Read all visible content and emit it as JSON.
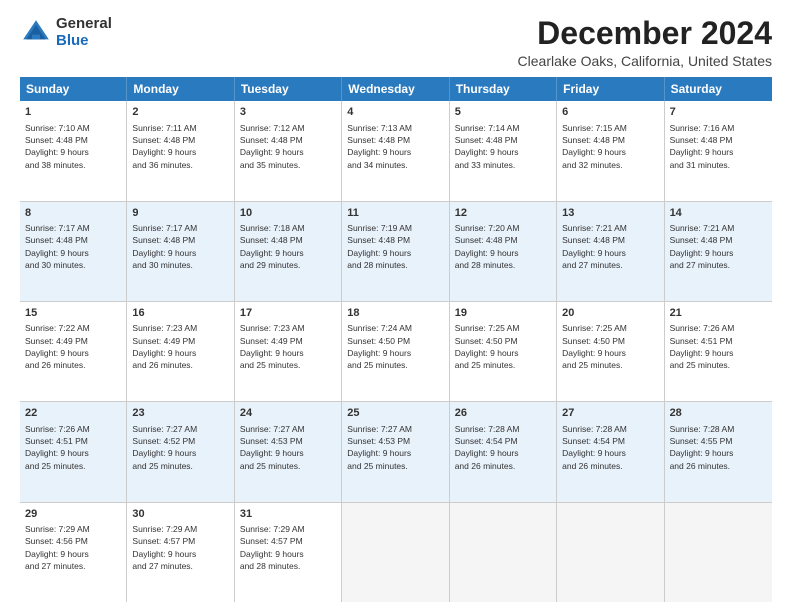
{
  "logo": {
    "general": "General",
    "blue": "Blue"
  },
  "title": "December 2024",
  "location": "Clearlake Oaks, California, United States",
  "days": [
    "Sunday",
    "Monday",
    "Tuesday",
    "Wednesday",
    "Thursday",
    "Friday",
    "Saturday"
  ],
  "weeks": [
    [
      {
        "day": "1",
        "info": "Sunrise: 7:10 AM\nSunset: 4:48 PM\nDaylight: 9 hours\nand 38 minutes."
      },
      {
        "day": "2",
        "info": "Sunrise: 7:11 AM\nSunset: 4:48 PM\nDaylight: 9 hours\nand 36 minutes."
      },
      {
        "day": "3",
        "info": "Sunrise: 7:12 AM\nSunset: 4:48 PM\nDaylight: 9 hours\nand 35 minutes."
      },
      {
        "day": "4",
        "info": "Sunrise: 7:13 AM\nSunset: 4:48 PM\nDaylight: 9 hours\nand 34 minutes."
      },
      {
        "day": "5",
        "info": "Sunrise: 7:14 AM\nSunset: 4:48 PM\nDaylight: 9 hours\nand 33 minutes."
      },
      {
        "day": "6",
        "info": "Sunrise: 7:15 AM\nSunset: 4:48 PM\nDaylight: 9 hours\nand 32 minutes."
      },
      {
        "day": "7",
        "info": "Sunrise: 7:16 AM\nSunset: 4:48 PM\nDaylight: 9 hours\nand 31 minutes."
      }
    ],
    [
      {
        "day": "8",
        "info": "Sunrise: 7:17 AM\nSunset: 4:48 PM\nDaylight: 9 hours\nand 30 minutes."
      },
      {
        "day": "9",
        "info": "Sunrise: 7:17 AM\nSunset: 4:48 PM\nDaylight: 9 hours\nand 30 minutes."
      },
      {
        "day": "10",
        "info": "Sunrise: 7:18 AM\nSunset: 4:48 PM\nDaylight: 9 hours\nand 29 minutes."
      },
      {
        "day": "11",
        "info": "Sunrise: 7:19 AM\nSunset: 4:48 PM\nDaylight: 9 hours\nand 28 minutes."
      },
      {
        "day": "12",
        "info": "Sunrise: 7:20 AM\nSunset: 4:48 PM\nDaylight: 9 hours\nand 28 minutes."
      },
      {
        "day": "13",
        "info": "Sunrise: 7:21 AM\nSunset: 4:48 PM\nDaylight: 9 hours\nand 27 minutes."
      },
      {
        "day": "14",
        "info": "Sunrise: 7:21 AM\nSunset: 4:48 PM\nDaylight: 9 hours\nand 27 minutes."
      }
    ],
    [
      {
        "day": "15",
        "info": "Sunrise: 7:22 AM\nSunset: 4:49 PM\nDaylight: 9 hours\nand 26 minutes."
      },
      {
        "day": "16",
        "info": "Sunrise: 7:23 AM\nSunset: 4:49 PM\nDaylight: 9 hours\nand 26 minutes."
      },
      {
        "day": "17",
        "info": "Sunrise: 7:23 AM\nSunset: 4:49 PM\nDaylight: 9 hours\nand 25 minutes."
      },
      {
        "day": "18",
        "info": "Sunrise: 7:24 AM\nSunset: 4:50 PM\nDaylight: 9 hours\nand 25 minutes."
      },
      {
        "day": "19",
        "info": "Sunrise: 7:25 AM\nSunset: 4:50 PM\nDaylight: 9 hours\nand 25 minutes."
      },
      {
        "day": "20",
        "info": "Sunrise: 7:25 AM\nSunset: 4:50 PM\nDaylight: 9 hours\nand 25 minutes."
      },
      {
        "day": "21",
        "info": "Sunrise: 7:26 AM\nSunset: 4:51 PM\nDaylight: 9 hours\nand 25 minutes."
      }
    ],
    [
      {
        "day": "22",
        "info": "Sunrise: 7:26 AM\nSunset: 4:51 PM\nDaylight: 9 hours\nand 25 minutes."
      },
      {
        "day": "23",
        "info": "Sunrise: 7:27 AM\nSunset: 4:52 PM\nDaylight: 9 hours\nand 25 minutes."
      },
      {
        "day": "24",
        "info": "Sunrise: 7:27 AM\nSunset: 4:53 PM\nDaylight: 9 hours\nand 25 minutes."
      },
      {
        "day": "25",
        "info": "Sunrise: 7:27 AM\nSunset: 4:53 PM\nDaylight: 9 hours\nand 25 minutes."
      },
      {
        "day": "26",
        "info": "Sunrise: 7:28 AM\nSunset: 4:54 PM\nDaylight: 9 hours\nand 26 minutes."
      },
      {
        "day": "27",
        "info": "Sunrise: 7:28 AM\nSunset: 4:54 PM\nDaylight: 9 hours\nand 26 minutes."
      },
      {
        "day": "28",
        "info": "Sunrise: 7:28 AM\nSunset: 4:55 PM\nDaylight: 9 hours\nand 26 minutes."
      }
    ],
    [
      {
        "day": "29",
        "info": "Sunrise: 7:29 AM\nSunset: 4:56 PM\nDaylight: 9 hours\nand 27 minutes."
      },
      {
        "day": "30",
        "info": "Sunrise: 7:29 AM\nSunset: 4:57 PM\nDaylight: 9 hours\nand 27 minutes."
      },
      {
        "day": "31",
        "info": "Sunrise: 7:29 AM\nSunset: 4:57 PM\nDaylight: 9 hours\nand 28 minutes."
      },
      {
        "day": "",
        "info": ""
      },
      {
        "day": "",
        "info": ""
      },
      {
        "day": "",
        "info": ""
      },
      {
        "day": "",
        "info": ""
      }
    ]
  ]
}
